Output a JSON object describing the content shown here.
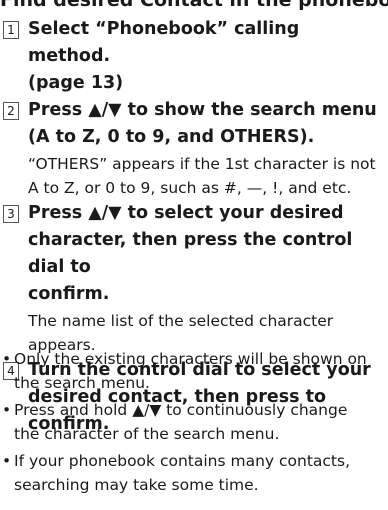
{
  "heading": "Find desired Contact in the phonebook",
  "steps": [
    {
      "number": "1",
      "title_lines": [
        "Select “Phonebook” calling method.",
        "(page 13)"
      ],
      "note_lines": []
    },
    {
      "number": "2",
      "title_lines": [
        "Press ▲/▼ to show the search menu",
        "(A to Z, 0 to 9, and OTHERS)."
      ],
      "note_lines": [
        "“OTHERS” appears if the 1st character is not",
        "A to Z, or 0 to 9, such as #, —, !, and etc."
      ]
    },
    {
      "number": "3",
      "title_lines": [
        "Press ▲/▼ to select your desired",
        "character, then press the control dial to",
        "confirm."
      ],
      "note_lines": [
        "The name list of the selected character",
        "appears."
      ]
    },
    {
      "number": "4",
      "title_lines": [
        "Turn the control dial to select your",
        "desired contact, then press to confirm."
      ],
      "note_lines": []
    }
  ],
  "bullets": [
    {
      "marker": "•",
      "lines": [
        "Only the existing characters will be shown on",
        "the search menu."
      ]
    },
    {
      "marker": "•",
      "lines": [
        "Press and hold ▲/▼ to continuously change",
        "the character of the search menu."
      ]
    },
    {
      "marker": "•",
      "lines": [
        "If your phonebook contains many contacts,",
        "searching may take some time."
      ]
    }
  ]
}
